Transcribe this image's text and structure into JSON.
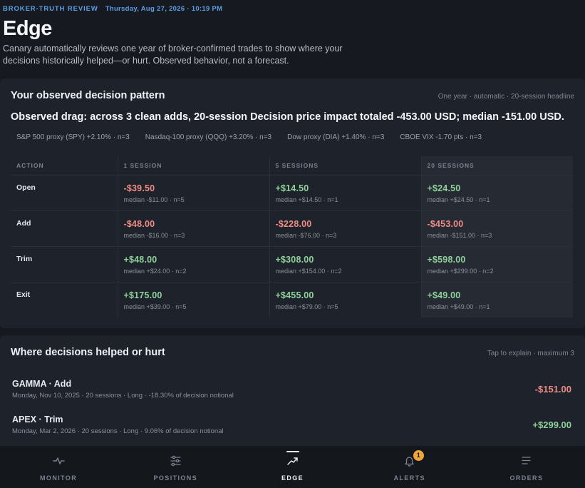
{
  "header": {
    "eyebrow": "BROKER-TRUTH REVIEW",
    "date": "Thursday, Aug 27, 2026 · 10:19 PM",
    "title": "Edge",
    "subtitle": "Canary automatically reviews one year of broker-confirmed trades to show where your decisions historically helped—or hurt. Observed behavior, not a forecast."
  },
  "pattern": {
    "title": "Your observed decision pattern",
    "meta": "One year · automatic · 20-session headline",
    "headline": "Observed drag: across 3 clean adds, 20-session Decision price impact totaled -453.00 USD; median -151.00 USD.",
    "proxies": [
      "S&P 500 proxy (SPY) +2.10% · n=3",
      "Nasdaq-100 proxy (QQQ) +3.20% · n=3",
      "Dow proxy (DIA) +1.40% · n=3",
      "CBOE VIX -1.70 pts · n=3"
    ],
    "columns": [
      "ACTION",
      "1 SESSION",
      "5 SESSIONS",
      "20 SESSIONS"
    ],
    "rows": [
      {
        "action": "Open",
        "cells": [
          {
            "value": "-$39.50",
            "median": "median -$11.00 · n=5",
            "sign": "neg"
          },
          {
            "value": "+$14.50",
            "median": "median +$14.50 · n=1",
            "sign": "pos"
          },
          {
            "value": "+$24.50",
            "median": "median +$24.50 · n=1",
            "sign": "pos"
          }
        ]
      },
      {
        "action": "Add",
        "cells": [
          {
            "value": "-$48.00",
            "median": "median -$16.00 · n=3",
            "sign": "neg"
          },
          {
            "value": "-$228.00",
            "median": "median -$76.00 · n=3",
            "sign": "neg"
          },
          {
            "value": "-$453.00",
            "median": "median -$151.00 · n=3",
            "sign": "neg"
          }
        ]
      },
      {
        "action": "Trim",
        "cells": [
          {
            "value": "+$48.00",
            "median": "median +$24.00 · n=2",
            "sign": "pos"
          },
          {
            "value": "+$308.00",
            "median": "median +$154.00 · n=2",
            "sign": "pos"
          },
          {
            "value": "+$598.00",
            "median": "median +$299.00 · n=2",
            "sign": "pos"
          }
        ]
      },
      {
        "action": "Exit",
        "cells": [
          {
            "value": "+$175.00",
            "median": "median +$39.00 · n=5",
            "sign": "pos"
          },
          {
            "value": "+$455.00",
            "median": "median +$79.00 · n=5",
            "sign": "pos"
          },
          {
            "value": "+$49.00",
            "median": "median +$49.00 · n=1",
            "sign": "pos"
          }
        ]
      }
    ]
  },
  "helped": {
    "title": "Where decisions helped or hurt",
    "meta": "Tap to explain · maximum 3",
    "items": [
      {
        "name": "GAMMA · Add",
        "sub": "Monday, Nov 10, 2025 · 20 sessions · Long · -18.30% of decision notional",
        "amount": "-$151.00",
        "sign": "neg"
      },
      {
        "name": "APEX · Trim",
        "sub": "Monday, Mar 2, 2026 · 20 sessions · Long · 9.06% of decision notional",
        "amount": "+$299.00",
        "sign": "pos"
      }
    ]
  },
  "tabs": [
    {
      "label": "MONITOR",
      "icon": "pulse-icon"
    },
    {
      "label": "POSITIONS",
      "icon": "sliders-icon"
    },
    {
      "label": "EDGE",
      "icon": "trend-up-icon",
      "active": true
    },
    {
      "label": "ALERTS",
      "icon": "bell-icon",
      "badge": "1"
    },
    {
      "label": "ORDERS",
      "icon": "list-icon"
    }
  ],
  "colors": {
    "background": "#16191f",
    "card": "#1e222a",
    "accent": "#5aa0e6",
    "positive": "#8fd19a",
    "negative": "#ee8b86",
    "badge": "#f0a53a"
  }
}
